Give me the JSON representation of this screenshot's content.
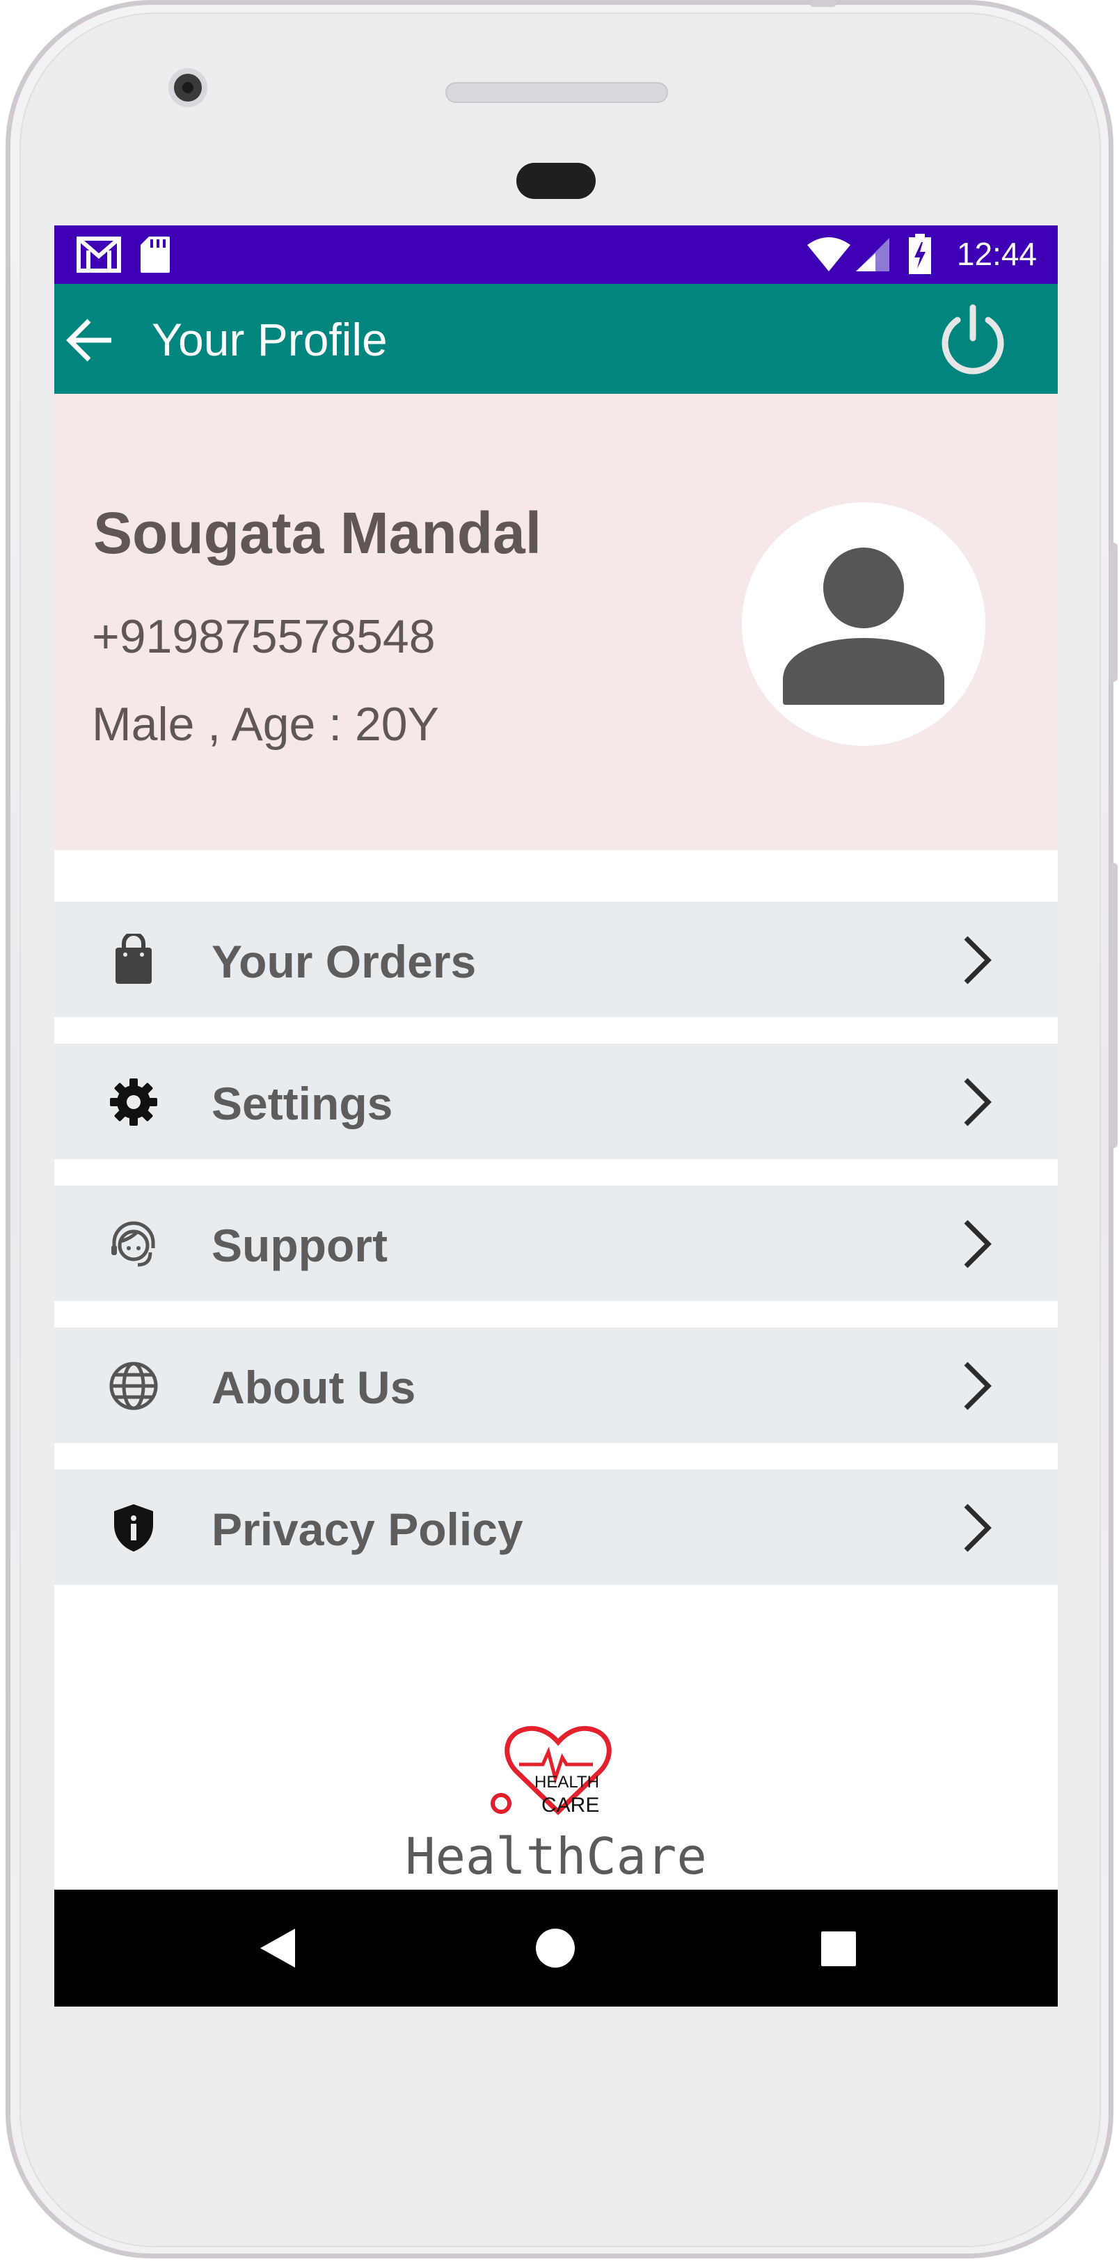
{
  "status_bar": {
    "time": "12:44",
    "left_icons": [
      "gmail-icon",
      "sd-card-icon"
    ],
    "right_icons": [
      "wifi-icon",
      "signal-icon",
      "battery-charging-icon"
    ],
    "color": "#3f00b5"
  },
  "app_bar": {
    "title": "Your Profile",
    "back_icon": "arrow-left-icon",
    "action_icon": "power-icon",
    "color": "#00857f"
  },
  "profile": {
    "name": "Sougata Mandal",
    "phone": "+919875578548",
    "details": "Male , Age : 20Y",
    "avatar_icon": "person-icon",
    "background": "#f6e8e9"
  },
  "menu": {
    "items": [
      {
        "label": "Your Orders",
        "icon": "shopping-bag-icon"
      },
      {
        "label": "Settings",
        "icon": "gear-icon"
      },
      {
        "label": "Support",
        "icon": "support-agent-icon"
      },
      {
        "label": "About Us",
        "icon": "globe-icon"
      },
      {
        "label": "Privacy Policy",
        "icon": "shield-info-icon"
      }
    ],
    "chevron_icon": "chevron-right-icon"
  },
  "footer": {
    "logo_line1": "HEALTH",
    "logo_line2": "CARE",
    "brand": "HealthCare",
    "logo_color": "#e4202c"
  },
  "nav_bar": {
    "icons": [
      "back-triangle-icon",
      "home-circle-icon",
      "recents-square-icon"
    ]
  }
}
